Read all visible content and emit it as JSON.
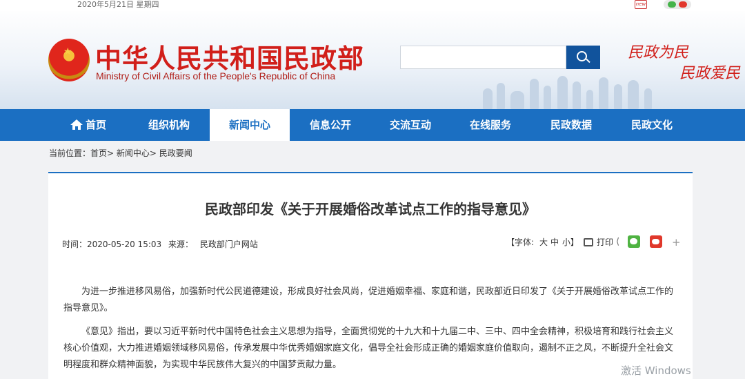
{
  "topbar": {
    "date": "2020年5月21日 星期四",
    "new_icon": "new",
    "social_icons": [
      "wechat-icon",
      "weibo-icon"
    ]
  },
  "header": {
    "title_cn": "中华人民共和国民政部",
    "title_en": "Ministry of Civil Affairs of the People's Republic of China",
    "search_placeholder": "",
    "slogan_1": "民政为民",
    "slogan_2": "民政爱民"
  },
  "nav": {
    "items": [
      {
        "label": "首页"
      },
      {
        "label": "组织机构"
      },
      {
        "label": "新闻中心"
      },
      {
        "label": "信息公开"
      },
      {
        "label": "交流互动"
      },
      {
        "label": "在线服务"
      },
      {
        "label": "民政数据"
      },
      {
        "label": "民政文化"
      }
    ],
    "active_index": 2
  },
  "breadcrumb": {
    "text": "当前位置：首页> 新闻中心> 民政要闻"
  },
  "article": {
    "title": "民政部印发《关于开展婚俗改革试点工作的指导意见》",
    "time_label": "时间：2020-05-20 15:03",
    "source_label": "来源：",
    "source": "民政部门户网站",
    "font_label": "【字体:",
    "font_large": "大",
    "font_medium": "中",
    "font_small": "小】",
    "print_label": "打印",
    "paragraphs": [
      "为进一步推进移风易俗，加强新时代公民道德建设，形成良好社会风尚，促进婚姻幸福、家庭和谐，民政部近日印发了《关于开展婚俗改革试点工作的指导意见》。",
      "《意见》指出，要以习近平新时代中国特色社会主义思想为指导，全面贯彻党的十九大和十九届二中、三中、四中全会精神，积极培育和践行社会主义核心价值观，大力推进婚姻领域移风易俗，传承发展中华优秀婚姻家庭文化，倡导全社会形成正确的婚姻家庭价值取向，遏制不正之风，不断提升全社会文明程度和群众精神面貌，为实现中华民族伟大复兴的中国梦贡献力量。"
    ]
  },
  "watermark": "激活 Windows",
  "colors": {
    "nav_blue": "#1b6fc2",
    "title_red": "#d11f1a",
    "search_button": "#11539c"
  }
}
